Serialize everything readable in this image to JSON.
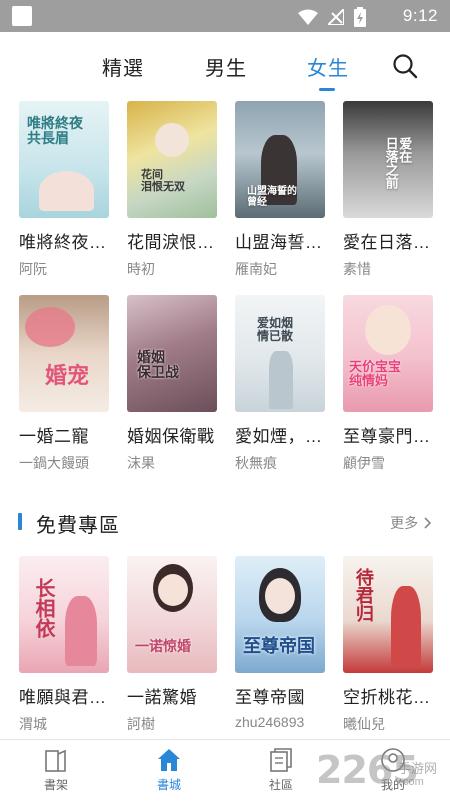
{
  "status_bar": {
    "time": "9:12"
  },
  "tabs": [
    {
      "label": "精選"
    },
    {
      "label": "男生"
    },
    {
      "label": "女生",
      "active": true
    }
  ],
  "colors": {
    "accent": "#2a86d6",
    "muted": "#888888"
  },
  "books_row1": [
    {
      "title": "唯將終夜…",
      "author": "阿阮",
      "cover_text": "唯將終夜\n共長眉"
    },
    {
      "title": "花間淚恨…",
      "author": "時初",
      "cover_text": "花间\n泪恨无双"
    },
    {
      "title": "山盟海誓…",
      "author": "雁南妃",
      "cover_text": "山盟海誓的\n曾经"
    },
    {
      "title": "愛在日落…",
      "author": "素惜",
      "cover_text": "爱在\n日落之前"
    }
  ],
  "books_row2": [
    {
      "title": "一婚二寵",
      "author": "一鍋大饅頭",
      "cover_text": "婚宠"
    },
    {
      "title": "婚姻保衛戰",
      "author": "沫果",
      "cover_text": "婚姻\n保卫战"
    },
    {
      "title": "愛如煙，…",
      "author": "秋無痕",
      "cover_text": "爱如烟\n情已散"
    },
    {
      "title": "至尊豪門…",
      "author": "顧伊雪",
      "cover_text": "天价宝宝\n纯情妈"
    }
  ],
  "free_section": {
    "title": "免費專區",
    "more": "更多"
  },
  "books_row3": [
    {
      "title": "唯願與君…",
      "author": "渭城",
      "cover_text": "长相依"
    },
    {
      "title": "一諾驚婚",
      "author": "訶樹",
      "cover_text": "一诺惊婚"
    },
    {
      "title": "至尊帝國",
      "author": "zhu246893",
      "cover_text": "至尊帝国"
    },
    {
      "title": "空折桃花…",
      "author": "曦仙兒",
      "cover_text": "待君归"
    }
  ],
  "bottom_nav": [
    {
      "label": "書架",
      "icon": "bookshelf-icon"
    },
    {
      "label": "書城",
      "icon": "bookstore-icon",
      "active": true
    },
    {
      "label": "社區",
      "icon": "community-icon"
    },
    {
      "label": "我的",
      "icon": "profile-icon"
    }
  ],
  "watermark": {
    "number": "2265",
    "text": "手游网",
    "domain": ".com"
  }
}
